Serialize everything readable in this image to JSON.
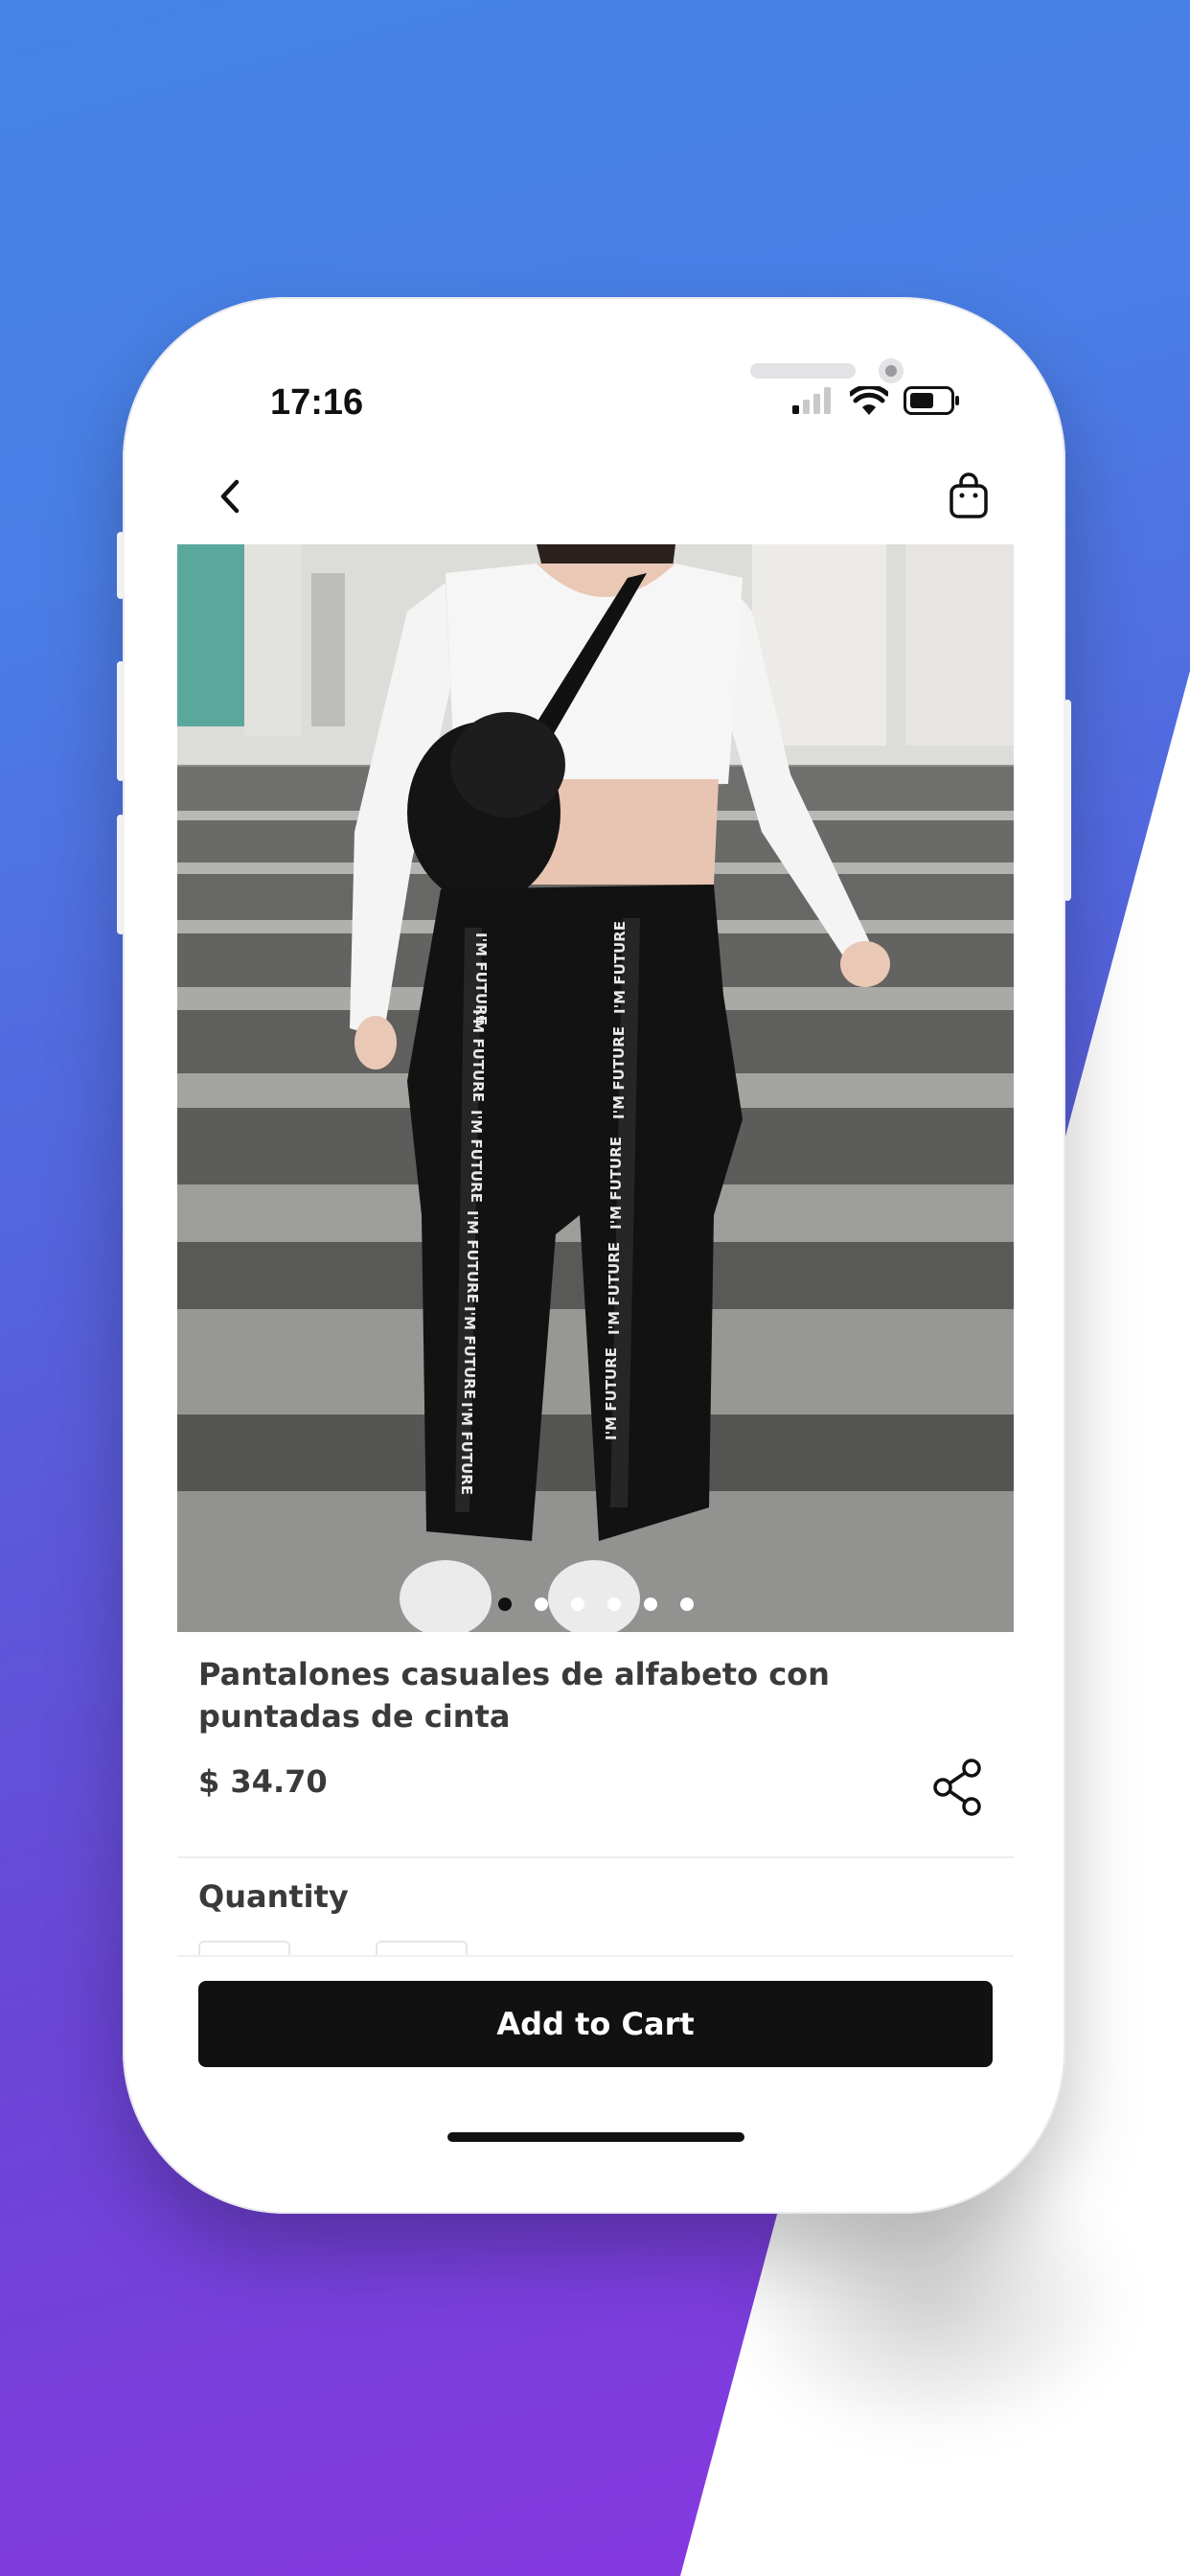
{
  "status_bar": {
    "time": "17:16",
    "icons": [
      "signal-icon",
      "wifi-icon",
      "battery-icon"
    ]
  },
  "nav": {
    "back_icon": "chevron-left-icon",
    "cart_icon": "shopping-bag-icon"
  },
  "product": {
    "title": "Pantalones casuales de alfabeto con puntadas de cinta",
    "price": "$ 34.70",
    "image_carousel": {
      "page_count": 6,
      "active_index": 0
    },
    "print_text": "I'M FUTURE"
  },
  "quantity": {
    "label": "Quantity"
  },
  "actions": {
    "add_to_cart_label": "Add to Cart",
    "share_icon": "share-icon"
  },
  "colors": {
    "bg_top": "#4484e6",
    "bg_bottom": "#8a36e2",
    "button_bg": "#111111",
    "text_primary": "#3a3a3a"
  }
}
